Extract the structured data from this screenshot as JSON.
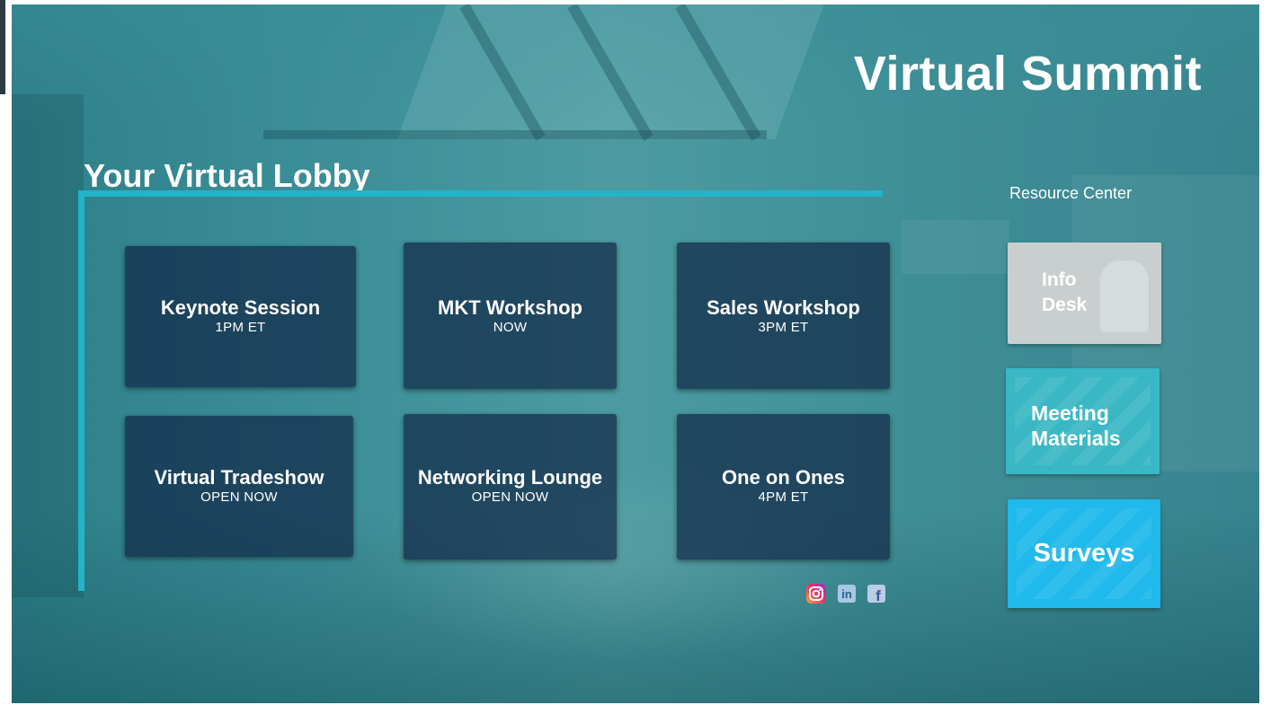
{
  "header": {
    "title": "Virtual Summit"
  },
  "lobby": {
    "title": "Your Virtual Lobby",
    "tiles": [
      {
        "name": "Keynote Session",
        "status": "1PM ET"
      },
      {
        "name": "MKT Workshop",
        "status": "NOW"
      },
      {
        "name": "Sales Workshop",
        "status": "3PM ET"
      },
      {
        "name": "Virtual Tradeshow",
        "status": "OPEN NOW"
      },
      {
        "name": "Networking Lounge",
        "status": "OPEN NOW"
      },
      {
        "name": "One on Ones",
        "status": "4PM ET"
      }
    ]
  },
  "resource_center": {
    "heading": "Resource Center",
    "buttons": [
      {
        "label_line1": "Info",
        "label_line2": "Desk"
      },
      {
        "label_line1": "Meeting",
        "label_line2": "Materials"
      },
      {
        "label": "Surveys"
      }
    ]
  },
  "social": {
    "icons": [
      "instagram-icon",
      "linkedin-icon",
      "facebook-icon"
    ],
    "linkedin_text": "in",
    "facebook_text": "f"
  },
  "colors": {
    "accent_line": "#22b4c8",
    "tile_bg": "#122848",
    "info_desk": "#c9cfcf",
    "meeting_materials": "#3ab7c4",
    "surveys": "#1fb9ec"
  }
}
